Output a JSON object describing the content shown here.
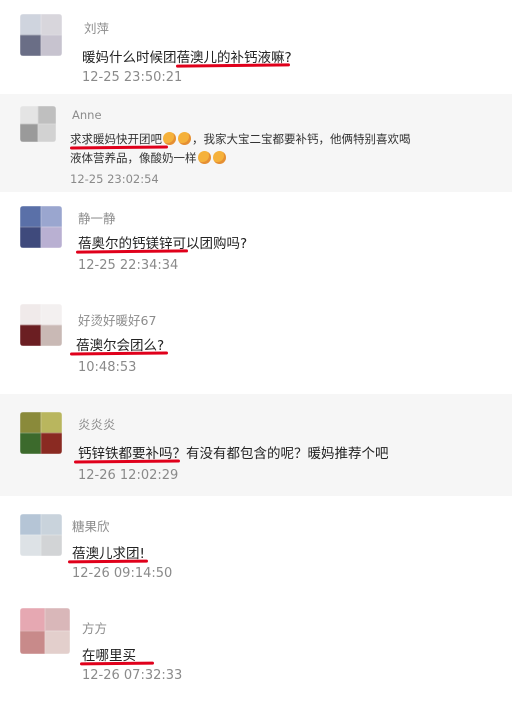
{
  "comments": [
    {
      "name": "刘萍",
      "text": "暖妈什么时候团蓓澳儿的补钙液嘛?",
      "time": "12-25 23:50:21"
    },
    {
      "name": "Anne",
      "text_line1": "求求暖妈快开团吧",
      "text_line1b": "，我家大宝二宝都要补钙，他俩特别喜欢喝",
      "text_line2": "液体营养品，像酸奶一样",
      "time": "12-25 23:02:54"
    },
    {
      "name": "静一静",
      "text": "蓓奥尔的钙镁锌可以团购吗?",
      "time": "12-25 22:34:34"
    },
    {
      "name": "好烫好暖好67",
      "text": "蓓澳尔会团么?",
      "time": "10:48:53"
    },
    {
      "name": "炎炎炎",
      "text": "钙锌铁都要补吗？有没有都包含的呢？暖妈推荐个吧",
      "time": "12-26 12:02:29"
    },
    {
      "name": "糖果欣",
      "text": "蓓澳儿求团!",
      "time": "12-26 09:14:50"
    },
    {
      "name": "方方",
      "text": "在哪里买",
      "time": "12-26 07:32:33"
    }
  ],
  "colors": {
    "highlight": "#e0001b",
    "name": "#8c8c8c",
    "time": "#8a8a8a"
  }
}
